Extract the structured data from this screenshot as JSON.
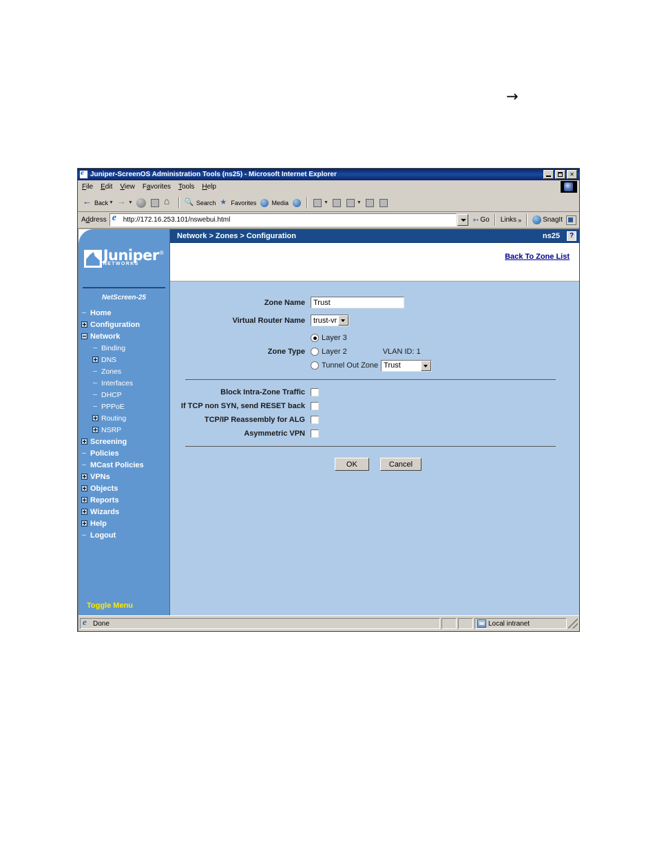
{
  "stray_glyph": "→",
  "window": {
    "title": "Juniper-ScreenOS Administration Tools (ns25) - Microsoft Internet Explorer",
    "min_label": "",
    "max_label": "",
    "close_label": "✕"
  },
  "menubar": {
    "items": [
      "File",
      "Edit",
      "View",
      "Favorites",
      "Tools",
      "Help"
    ]
  },
  "toolbar": {
    "back_label": "Back",
    "forward_label": "",
    "stop_label": "",
    "refresh_label": "",
    "home_label": "",
    "search_label": "Search",
    "favorites_label": "Favorites",
    "media_label": "Media",
    "history_label": "",
    "mail_label": "",
    "print_label": "",
    "edit_label": "",
    "discuss_label": "",
    "messenger_label": ""
  },
  "address": {
    "label": "Address",
    "url": "http://172.16.253.101/nswebui.html",
    "placeholder": "",
    "go_label": "Go",
    "links_label": "Links",
    "links_chevron": "»",
    "snagit_label": "SnagIt"
  },
  "sidebar": {
    "logo_name": "Juniper",
    "logo_registered": "®",
    "logo_sub": "NETWORKS",
    "model": "NetScreen-25",
    "toggle_label": "Toggle Menu",
    "items": [
      {
        "label": "Home",
        "level": 1,
        "expander": "dash"
      },
      {
        "label": "Configuration",
        "level": 1,
        "expander": "plus"
      },
      {
        "label": "Network",
        "level": 1,
        "expander": "minus"
      },
      {
        "label": "Binding",
        "level": 2,
        "expander": "dash"
      },
      {
        "label": "DNS",
        "level": 2,
        "expander": "plus"
      },
      {
        "label": "Zones",
        "level": 2,
        "expander": "dash"
      },
      {
        "label": "Interfaces",
        "level": 2,
        "expander": "dash"
      },
      {
        "label": "DHCP",
        "level": 2,
        "expander": "dash"
      },
      {
        "label": "PPPoE",
        "level": 2,
        "expander": "dash"
      },
      {
        "label": "Routing",
        "level": 2,
        "expander": "plus"
      },
      {
        "label": "NSRP",
        "level": 2,
        "expander": "plus"
      },
      {
        "label": "Screening",
        "level": 1,
        "expander": "plus"
      },
      {
        "label": "Policies",
        "level": 1,
        "expander": "dash"
      },
      {
        "label": "MCast Policies",
        "level": 1,
        "expander": "dash"
      },
      {
        "label": "VPNs",
        "level": 1,
        "expander": "plus"
      },
      {
        "label": "Objects",
        "level": 1,
        "expander": "plus"
      },
      {
        "label": "Reports",
        "level": 1,
        "expander": "plus"
      },
      {
        "label": "Wizards",
        "level": 1,
        "expander": "plus"
      },
      {
        "label": "Help",
        "level": 1,
        "expander": "plus"
      },
      {
        "label": "Logout",
        "level": 1,
        "expander": "dash"
      }
    ]
  },
  "header": {
    "breadcrumb": "Network > Zones > Configuration",
    "device": "ns25",
    "help_label": "?",
    "back_link": "Back To Zone List"
  },
  "form": {
    "zone_name_label": "Zone Name",
    "zone_name_value": "Trust",
    "virtual_router_label": "Virtual Router Name",
    "virtual_router_value": "trust-vr",
    "zone_type_label": "Zone Type",
    "zone_type_options": [
      {
        "label": "Layer 3",
        "selected": true
      },
      {
        "label": "Layer 2",
        "selected": false
      },
      {
        "label": "Tunnel Out Zone",
        "selected": false
      }
    ],
    "vlan_id_label": "VLAN ID: 1",
    "tunnel_out_zone_value": "Trust",
    "checkboxes": [
      {
        "label": "Block Intra-Zone Traffic",
        "checked": false
      },
      {
        "label": "If TCP non SYN, send RESET back",
        "checked": false
      },
      {
        "label": "TCP/IP Reassembly for ALG",
        "checked": false
      },
      {
        "label": "Asymmetric VPN",
        "checked": false
      }
    ],
    "ok_label": "OK",
    "cancel_label": "Cancel"
  },
  "statusbar": {
    "message": "Done",
    "zone": "Local intranet"
  },
  "colors": {
    "sidebar_bg": "#6197d0",
    "content_bg": "#b0cbe8",
    "breadcrumb_bg": "#1a4a8a",
    "toggle_menu": "#ffe800",
    "link": "#00008b"
  }
}
